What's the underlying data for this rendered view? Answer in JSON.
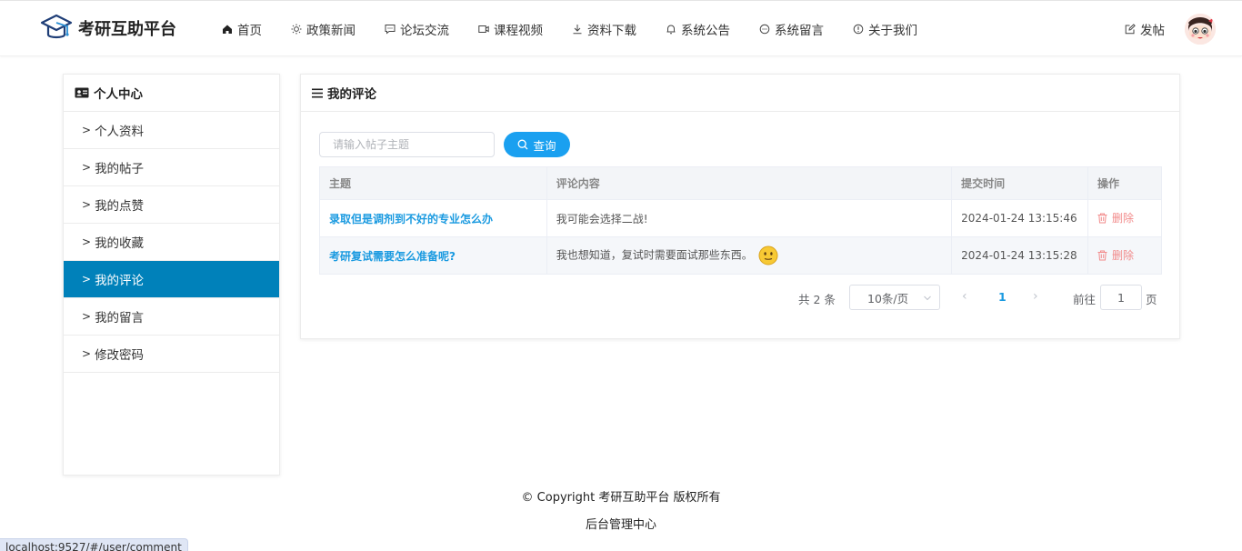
{
  "header": {
    "logo_text": "考研互助平台",
    "nav": [
      {
        "label": "首页",
        "icon": "home-icon"
      },
      {
        "label": "政策新闻",
        "icon": "sun-icon"
      },
      {
        "label": "论坛交流",
        "icon": "chat-square-icon"
      },
      {
        "label": "课程视频",
        "icon": "video-icon"
      },
      {
        "label": "资料下载",
        "icon": "download-icon"
      },
      {
        "label": "系统公告",
        "icon": "bell-icon"
      },
      {
        "label": "系统留言",
        "icon": "message-icon"
      },
      {
        "label": "关于我们",
        "icon": "info-icon"
      }
    ],
    "post_label": "发帖"
  },
  "sidebar": {
    "title": "个人中心",
    "items": [
      {
        "label": "个人资料"
      },
      {
        "label": "我的帖子"
      },
      {
        "label": "我的点赞"
      },
      {
        "label": "我的收藏"
      },
      {
        "label": "我的评论",
        "active": true
      },
      {
        "label": "我的留言"
      },
      {
        "label": "修改密码"
      }
    ],
    "chevron": ">"
  },
  "main": {
    "title": "我的评论",
    "search_placeholder": "请输入帖子主题",
    "query_label": "查询",
    "columns": [
      "主题",
      "评论内容",
      "提交时间",
      "操作"
    ],
    "rows": [
      {
        "topic": "录取但是调剂到不好的专业怎么办",
        "content": "我可能会选择二战!",
        "time": "2024-01-24 13:15:46",
        "action": "删除",
        "has_emoji": false
      },
      {
        "topic": "考研复试需要怎么准备呢?",
        "content": "我也想知道，复试时需要面试那些东西。",
        "time": "2024-01-24 13:15:28",
        "action": "删除",
        "has_emoji": true
      }
    ],
    "pagination": {
      "total": "共 2 条",
      "page_size": "10条/页",
      "current_page": "1",
      "goto_label": "前往",
      "goto_value": "1",
      "goto_unit": "页"
    }
  },
  "footer": {
    "copyright": "© Copyright 考研互助平台 版权所有",
    "admin_link": "后台管理中心"
  },
  "status_bar": {
    "url": "localhost:9527/#/user/comment"
  },
  "colors": {
    "accent": "#0081ba",
    "link": "#1a9ae0",
    "button": "#1aa0f0",
    "danger": "#f28b8b"
  }
}
